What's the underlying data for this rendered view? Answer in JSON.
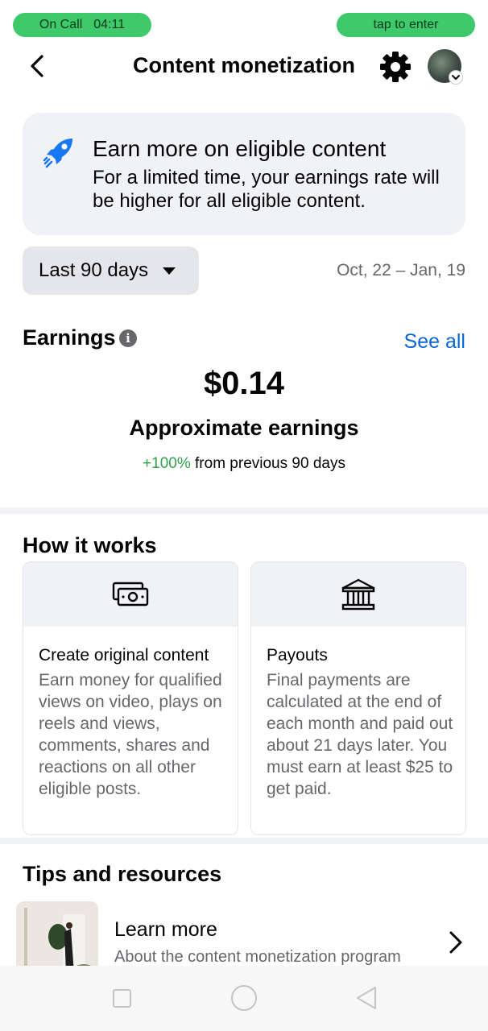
{
  "status": {
    "call_label": "On Call",
    "call_time": "04:11",
    "tap_label": "tap to enter"
  },
  "header": {
    "title": "Content monetization",
    "back_icon": "back-arrow-icon",
    "settings_icon": "gear-icon"
  },
  "promo": {
    "icon": "rocket-icon",
    "title": "Earn more on eligible content",
    "body": "For a limited time, your earnings rate will be higher for all eligible content."
  },
  "filter": {
    "selected": "Last 90 days",
    "date_range": "Oct, 22 – Jan, 19"
  },
  "earnings": {
    "heading": "Earnings",
    "see_all": "See all",
    "amount": "$0.14",
    "label": "Approximate earnings",
    "change": "+100%",
    "change_suffix": " from previous 90 days"
  },
  "how_it_works": {
    "heading": "How it works",
    "cards": [
      {
        "icon": "cash-icon",
        "title": "Create original content",
        "body": "Earn money for qualified views on video, plays on reels and views, comments, shares and reactions on all other eligible posts."
      },
      {
        "icon": "bank-icon",
        "title": "Payouts",
        "body": "Final payments are calculated at the end of each month and paid out about 21 days later. You must earn at least $25 to get paid."
      }
    ]
  },
  "tips": {
    "heading": "Tips and resources",
    "items": [
      {
        "title": "Learn more",
        "subtitle": "About the content monetization program"
      }
    ]
  },
  "colors": {
    "accent_blue": "#0866d6",
    "positive_green": "#31a24c",
    "call_pill_green": "#3ec96a",
    "secondary_text": "#65676b",
    "card_bg": "#f0f2f5"
  }
}
